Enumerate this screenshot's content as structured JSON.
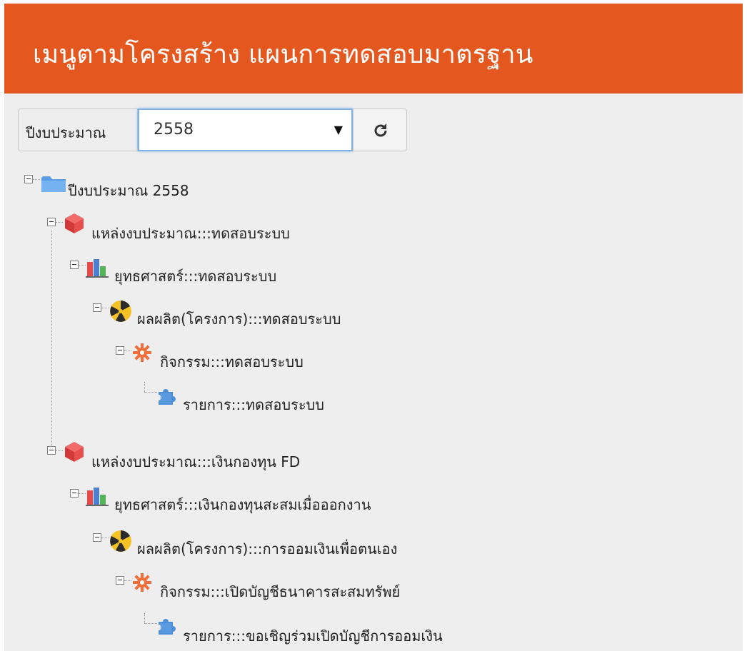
{
  "header": {
    "title": "เมนูตามโครงสร้าง แผนการทดสอบมาตรฐาน"
  },
  "toolbar": {
    "year_label": "ปีงบประมาณ",
    "year_value": "2558"
  },
  "tree": {
    "root": {
      "label": "ปีงบประมาณ 2558",
      "icon": "folder-icon"
    },
    "nodes": [
      {
        "label": "แหล่งงบประมาณ:::ทดสอบระบบ",
        "icon": "cube-icon"
      },
      {
        "label": "ยุทธศาสตร์:::ทดสอบระบบ",
        "icon": "bar-chart-icon"
      },
      {
        "label": "ผลผลิต(โครงการ):::ทดสอบระบบ",
        "icon": "radiation-icon"
      },
      {
        "label": "กิจกรรม:::ทดสอบระบบ",
        "icon": "gear-icon"
      },
      {
        "label": "รายการ:::ทดสอบระบบ",
        "icon": "puzzle-icon"
      },
      {
        "label": "แหล่งงบประมาณ:::เงินกองทุน FD",
        "icon": "cube-icon"
      },
      {
        "label": "ยุทธศาสตร์:::เงินกองทุนสะสมเมื่อออกงาน",
        "icon": "bar-chart-icon"
      },
      {
        "label": "ผลผลิต(โครงการ):::การออมเงินเพื่อตนเอง",
        "icon": "radiation-icon"
      },
      {
        "label": "กิจกรรม:::เปิดบัญชีธนาคารสะสมทรัพย์",
        "icon": "gear-icon"
      },
      {
        "label": "รายการ:::ขอเชิญร่วมเปิดบัญชีการออมเงิน",
        "icon": "puzzle-icon"
      }
    ]
  }
}
